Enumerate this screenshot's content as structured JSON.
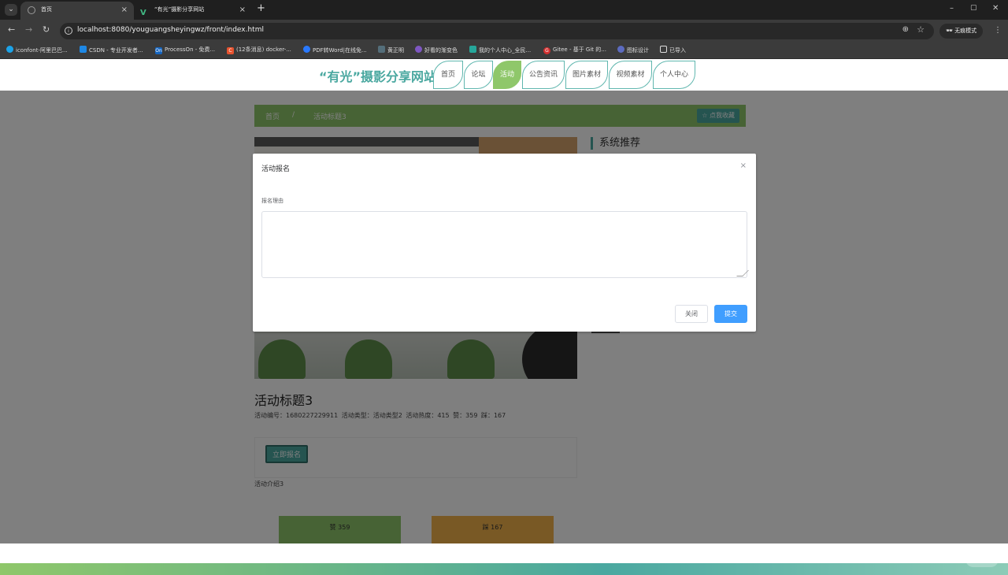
{
  "browser": {
    "tabs": [
      {
        "label": "首页"
      },
      {
        "label": "“有光”摄影分享网站"
      }
    ],
    "new_tab": "+",
    "window_controls": [
      "–",
      "▢",
      "✕"
    ],
    "url": "localhost:8080/youguangsheyingwz/front/index.html",
    "incognito_label": "无痕模式",
    "bookmarks": [
      {
        "label": "iconfont-阿里巴巴...",
        "color": "#1ca3e8"
      },
      {
        "label": "CSDN - 专业开发者...",
        "color": "#1e88e5"
      },
      {
        "label": "ProcessOn - 免费...",
        "color": "#1565c0",
        "icon_text": "On"
      },
      {
        "label": "(12条消息) docker-...",
        "color": "#e8532f",
        "icon_text": "C"
      },
      {
        "label": "PDF转Word|在线免...",
        "color": "#2979ff"
      },
      {
        "label": "黄正明",
        "color": "#546e7a"
      },
      {
        "label": "好看的渐变色",
        "color": "#7e57c2"
      },
      {
        "label": "我的个人中心_全民...",
        "color": "#26a69a"
      },
      {
        "label": "Gitee - 基于 Git 的...",
        "color": "#d32f2f",
        "icon_text": "G"
      },
      {
        "label": "图标设计",
        "color": "#5c6bc0"
      },
      {
        "label": "已导入",
        "color": "#3b3b3b"
      }
    ]
  },
  "site": {
    "logo": "“有光”摄影分享网站",
    "nav": [
      {
        "label": "首页",
        "active": false
      },
      {
        "label": "论坛",
        "active": false
      },
      {
        "label": "活动",
        "active": true
      },
      {
        "label": "公告资讯",
        "active": false
      },
      {
        "label": "图片素材",
        "active": false
      },
      {
        "label": "视频素材",
        "active": false
      },
      {
        "label": "个人中心",
        "active": false
      }
    ],
    "accent_color": "#8fc76a",
    "brand_color": "#4aa8a0"
  },
  "breadcrumb": {
    "home": "首页",
    "separator": "/",
    "current": "活动标题3",
    "favorite_button": "☆ 点我收藏"
  },
  "sidebar": {
    "title": "系统推荐"
  },
  "activity": {
    "title": "活动标题3",
    "meta": "活动编号：1680227229911   活动类型：活动类型2   活动热度：415   赞：359   踩：167",
    "signup_button": "立即报名",
    "intro": "活动介绍3",
    "like_label": "赞   359",
    "dislike_label": "踩   167"
  },
  "watermark": "小红书",
  "dialog": {
    "title": "活动报名",
    "close_icon": "×",
    "field_label": "报名理由",
    "textarea_value": "",
    "cancel_button": "关闭",
    "submit_button": "提交"
  }
}
